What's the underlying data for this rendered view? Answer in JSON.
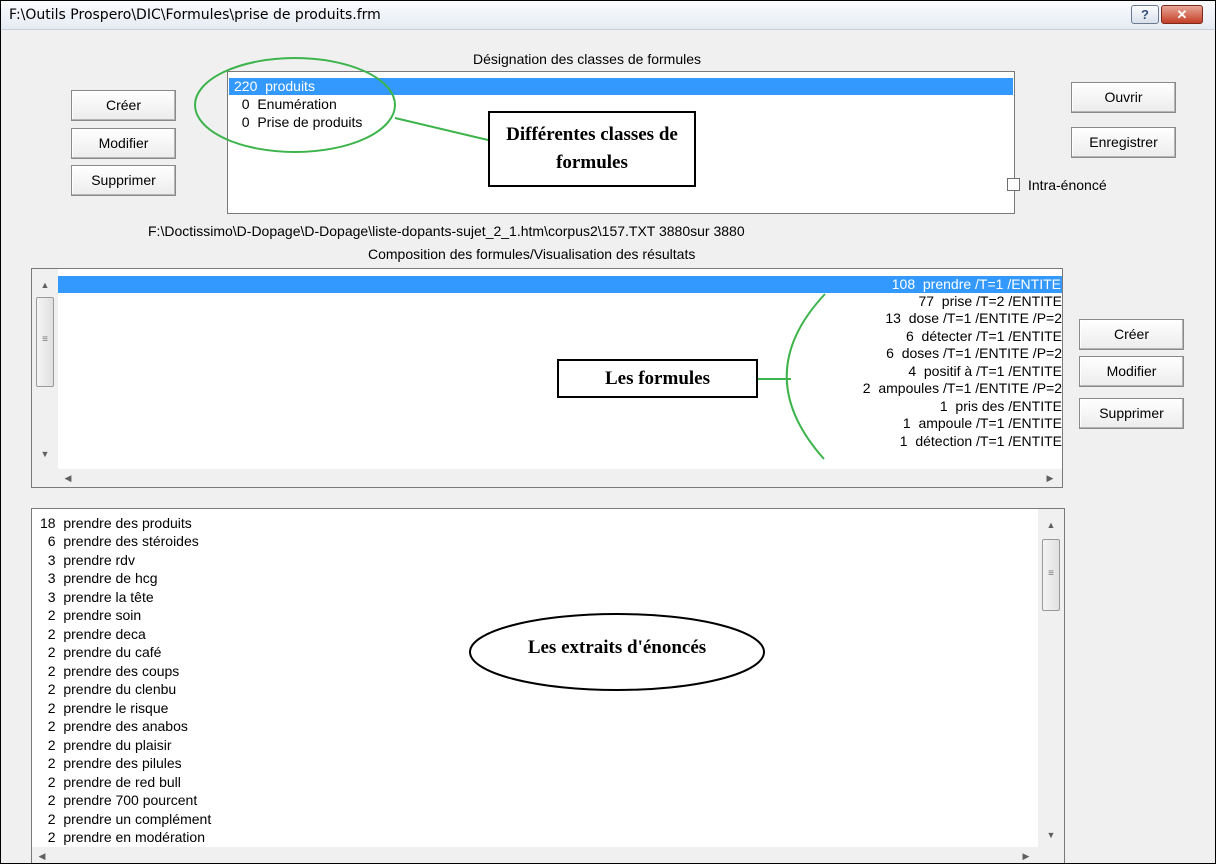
{
  "window": {
    "title": "F:\\Outils Prospero\\DIC\\Formules\\prise de produits.frm",
    "help_glyph": "?",
    "close_glyph": "✕"
  },
  "classes": {
    "heading": "Désignation des classes de formules",
    "items": [
      "220  produits",
      "  0  Enumération",
      "  0  Prise de produits"
    ],
    "selected_index": 0,
    "buttons": {
      "create": "Créer",
      "modify": "Modifier",
      "delete": "Supprimer"
    }
  },
  "file_actions": {
    "open": "Ouvrir",
    "save": "Enregistrer"
  },
  "intra": {
    "label": "Intra-énoncé",
    "checked": false
  },
  "path_line": "F:\\Doctissimo\\D-Dopage\\D-Dopage\\liste-dopants-sujet_2_1.htm\\corpus2\\157.TXT 3880sur 3880",
  "composition": {
    "heading": "Composition des formules/Visualisation des résultats",
    "items": [
      "108  prendre /T=1 /ENTITE",
      "77  prise /T=2 /ENTITE",
      "13  dose /T=1 /ENTITE /P=2",
      "6  détecter /T=1 /ENTITE",
      "6  doses /T=1 /ENTITE /P=2",
      "4  positif à /T=1 /ENTITE",
      "2  ampoules /T=1 /ENTITE /P=2",
      "1  pris des /ENTITE",
      "1  ampoule /T=1 /ENTITE",
      "1  détection /T=1 /ENTITE"
    ],
    "selected_index": 0,
    "buttons": {
      "create": "Créer",
      "modify": "Modifier",
      "delete": "Supprimer"
    }
  },
  "extracts": {
    "items": [
      "18  prendre des produits",
      "  6  prendre des stéroides",
      "  3  prendre rdv",
      "  3  prendre de hcg",
      "  3  prendre la tête",
      "  2  prendre soin",
      "  2  prendre deca",
      "  2  prendre du café",
      "  2  prendre des coups",
      "  2  prendre du clenbu",
      "  2  prendre le risque",
      "  2  prendre des anabos",
      "  2  prendre du plaisir",
      "  2  prendre des pilules",
      "  2  prendre de red bull",
      "  2  prendre 700 pourcent",
      "  2  prendre un complément",
      "  2  prendre en modération"
    ]
  },
  "annotations": {
    "classes_callout": "Différentes classes de formules",
    "formulas_callout": "Les formules",
    "extracts_callout": "Les extraits d'énoncés",
    "circle_color": "#3cb44b"
  }
}
